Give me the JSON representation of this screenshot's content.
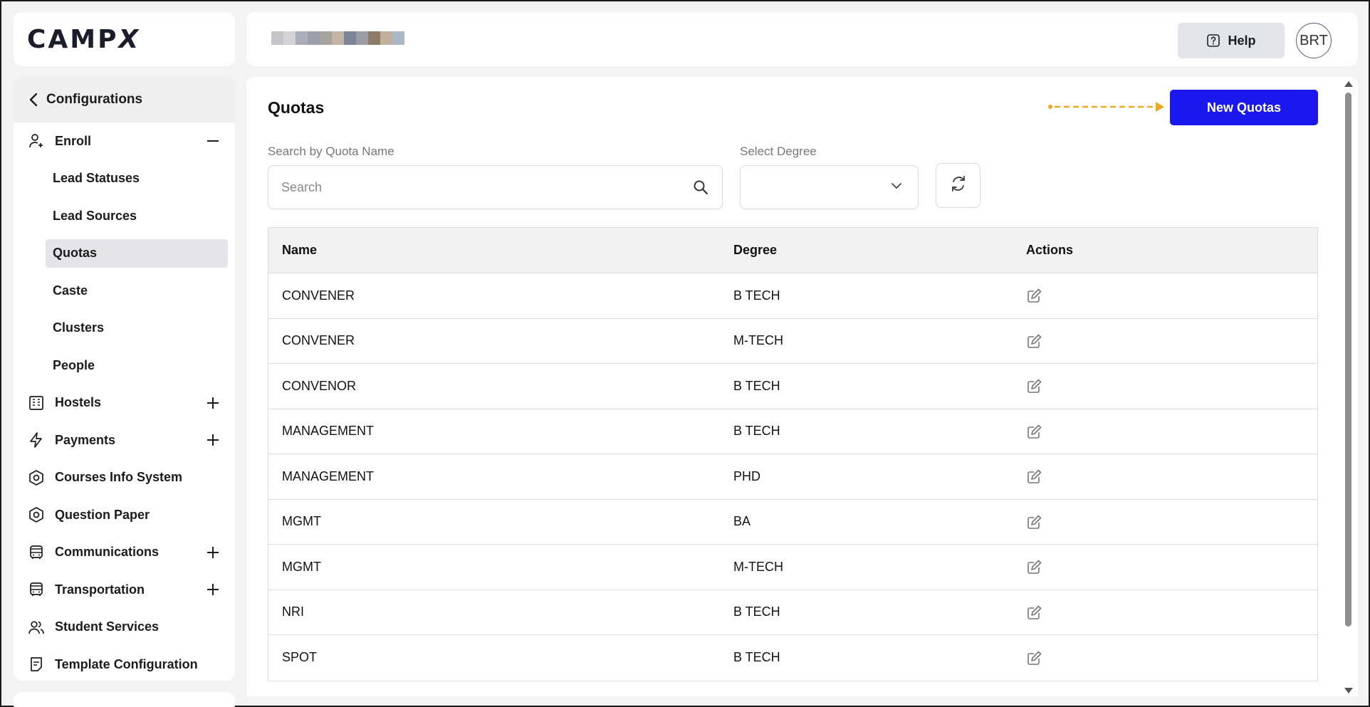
{
  "brand": {
    "logo_text": "CAMP",
    "logo_x": "X"
  },
  "header": {
    "help_label": "Help",
    "avatar_initials": "BRT"
  },
  "sidebar": {
    "back_label": "Configurations",
    "enroll": {
      "label": "Enroll",
      "sub_items": [
        "Lead Statuses",
        "Lead Sources",
        "Quotas",
        "Caste",
        "Clusters",
        "People"
      ],
      "active": "Quotas"
    },
    "items": [
      {
        "label": "Hostels",
        "icon": "building-icon",
        "expandable": true
      },
      {
        "label": "Payments",
        "icon": "lightning-icon",
        "expandable": true
      },
      {
        "label": "Courses Info System",
        "icon": "hexagon-icon",
        "expandable": false
      },
      {
        "label": "Question Paper",
        "icon": "hexagon-icon",
        "expandable": false
      },
      {
        "label": "Communications",
        "icon": "bus-icon",
        "expandable": true
      },
      {
        "label": "Transportation",
        "icon": "bus-icon",
        "expandable": true
      },
      {
        "label": "Student Services",
        "icon": "users-icon",
        "expandable": false
      },
      {
        "label": "Template Configuration",
        "icon": "document-icon",
        "expandable": false
      }
    ]
  },
  "main": {
    "title": "Quotas",
    "new_button_label": "New Quotas",
    "search": {
      "label": "Search by Quota Name",
      "placeholder": "Search",
      "value": ""
    },
    "degree_select": {
      "label": "Select Degree",
      "value": ""
    },
    "table": {
      "columns": [
        "Name",
        "Degree",
        "Actions"
      ],
      "rows": [
        {
          "name": "CONVENER",
          "degree": "B TECH"
        },
        {
          "name": "CONVENER",
          "degree": "M-TECH"
        },
        {
          "name": "CONVENOR",
          "degree": "B TECH"
        },
        {
          "name": "MANAGEMENT",
          "degree": "B TECH"
        },
        {
          "name": "MANAGEMENT",
          "degree": "PHD"
        },
        {
          "name": "MGMT",
          "degree": "BA"
        },
        {
          "name": "MGMT",
          "degree": "M-TECH"
        },
        {
          "name": "NRI",
          "degree": "B TECH"
        },
        {
          "name": "SPOT",
          "degree": "B TECH"
        }
      ]
    }
  },
  "colors": {
    "primary_button": "#1a18ee",
    "arrow_accent": "#f2a81d"
  }
}
